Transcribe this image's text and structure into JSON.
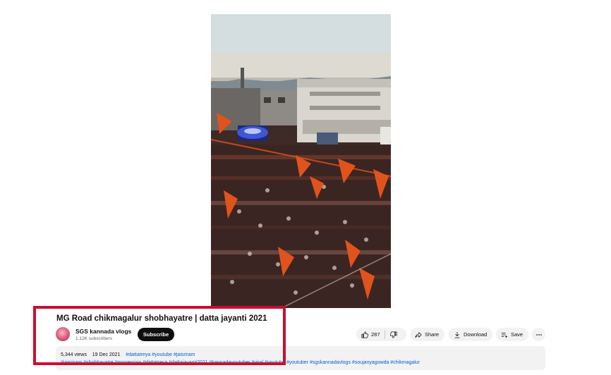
{
  "video": {
    "thumbnail_description_icon": "video-frame"
  },
  "title": "MG Road chikmagalur shobhayatre | datta jayanti 2021",
  "channel": {
    "name": "SGS kannada vlogs",
    "subscribers": "1.12K subscribers",
    "subscribe_label": "Subscribe"
  },
  "actions": {
    "likes": "287",
    "share_label": "Share",
    "download_label": "Download",
    "save_label": "Save"
  },
  "description": {
    "views": "5,344 views",
    "date": "19 Dec 2021",
    "tags_inline": "#dattatreya #youtube #jaisriram",
    "tags_line": "#jaisriram #shobhayatre #procession #dattatreya #dattajayanti2021 #kannadayoutuber #viral #youtube #youtuber #sgskannadavlogs #soujanyagowda #chikmagalur"
  },
  "colors": {
    "highlight": "#c8102e",
    "link": "#065fd4",
    "subscribe_bg": "#0f0f0f"
  }
}
